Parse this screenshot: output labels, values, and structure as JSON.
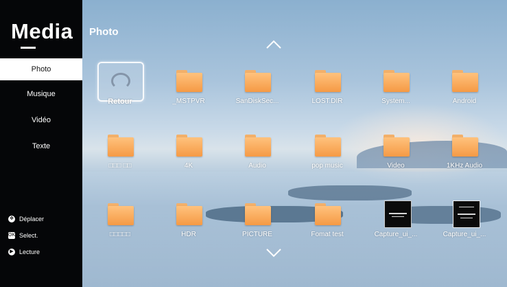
{
  "app": {
    "title": "Media"
  },
  "sidebar": {
    "items": [
      {
        "label": "Photo",
        "active": true
      },
      {
        "label": "Musique",
        "active": false
      },
      {
        "label": "Vidéo",
        "active": false
      },
      {
        "label": "Texte",
        "active": false
      }
    ],
    "hints": [
      {
        "icon": "dpad-icon",
        "label": "Déplacer"
      },
      {
        "icon": "ok-icon",
        "label": "Select."
      },
      {
        "icon": "play-icon",
        "label": "Lecture"
      }
    ]
  },
  "main": {
    "title": "Photo",
    "items": [
      {
        "label": "Retour",
        "type": "back"
      },
      {
        "label": "_MSTPVR",
        "type": "folder"
      },
      {
        "label": "SanDiskSec...",
        "type": "folder"
      },
      {
        "label": "LOST.DIR",
        "type": "folder"
      },
      {
        "label": "System...",
        "type": "folder"
      },
      {
        "label": "Android",
        "type": "folder"
      },
      {
        "label": "□□□ □□",
        "type": "folder"
      },
      {
        "label": "4K",
        "type": "folder"
      },
      {
        "label": "Audio",
        "type": "folder"
      },
      {
        "label": "pop music",
        "type": "folder"
      },
      {
        "label": "Video",
        "type": "folder"
      },
      {
        "label": "1KHz Audio",
        "type": "folder"
      },
      {
        "label": "□□□□□",
        "type": "folder"
      },
      {
        "label": "HDR",
        "type": "folder"
      },
      {
        "label": "PICTURE",
        "type": "folder"
      },
      {
        "label": "Fomat test",
        "type": "folder"
      },
      {
        "label": "Capture_ui_...",
        "type": "image"
      },
      {
        "label": "Capture_ui_...",
        "type": "image"
      }
    ]
  },
  "colors": {
    "sidebar_bg": "#050608",
    "folder": "#f59a45",
    "accent": "#ffffff"
  }
}
